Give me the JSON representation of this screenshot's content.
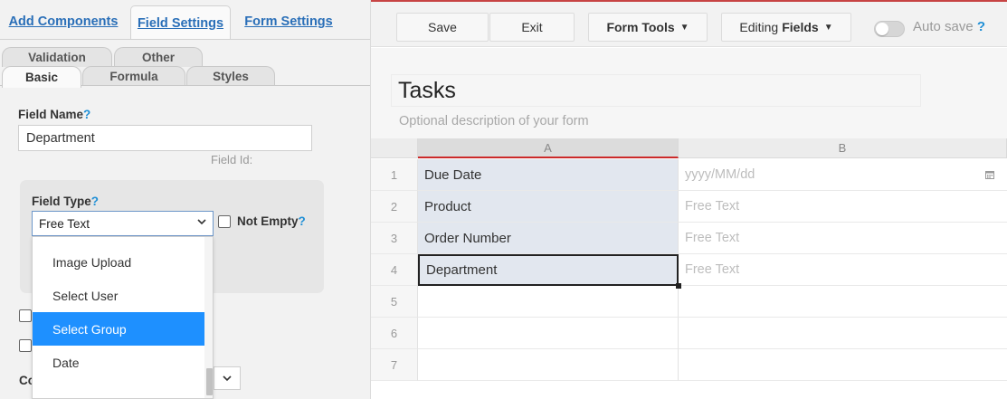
{
  "left_panel": {
    "top_tabs": [
      {
        "label": "Add Components",
        "active": false
      },
      {
        "label": "Field Settings",
        "active": true
      },
      {
        "label": "Form Settings",
        "active": false
      }
    ],
    "sub_tabs": {
      "validation": "Validation",
      "other": "Other",
      "basic": "Basic",
      "formula": "Formula",
      "styles": "Styles"
    },
    "field_name": {
      "label": "Field Name",
      "help": "?",
      "value": "Department"
    },
    "field_id_label": "Field Id:",
    "field_type": {
      "label": "Field Type",
      "help": "?",
      "selected": "Free Text",
      "options": [
        "Image Upload",
        "Select User",
        "Select Group",
        "Date"
      ],
      "highlighted_option": "Select Group"
    },
    "not_empty": {
      "label": "Not Empty",
      "help": "?",
      "checked": false
    },
    "partial_label": "Co"
  },
  "toolbar": {
    "save_label": "Save",
    "exit_label": "Exit",
    "form_tools_label": "Form Tools",
    "editing_prefix": "Editing",
    "editing_mode": "Fields",
    "autosave_label": "Auto save",
    "autosave_help": "?",
    "autosave_on": false
  },
  "form": {
    "title": "Tasks",
    "description_placeholder": "Optional description of your form"
  },
  "grid": {
    "columns": [
      "A",
      "B"
    ],
    "rows": [
      {
        "num": "1",
        "a": "Due Date",
        "b": "yyyy/MM/dd",
        "b_icon": "calendar-icon"
      },
      {
        "num": "2",
        "a": "Product",
        "b": "Free Text"
      },
      {
        "num": "3",
        "a": "Order Number",
        "b": "Free Text"
      },
      {
        "num": "4",
        "a": "Department",
        "b": "Free Text"
      },
      {
        "num": "5",
        "a": "",
        "b": ""
      },
      {
        "num": "6",
        "a": "",
        "b": ""
      },
      {
        "num": "7",
        "a": "",
        "b": ""
      }
    ]
  },
  "colors": {
    "link_blue": "#2a6fb8",
    "help_blue": "#1f8fd6",
    "selected_option_blue": "#1e90ff",
    "active_column_red": "#cc2a2a",
    "filled_cell_bg": "#e2e7ef"
  }
}
